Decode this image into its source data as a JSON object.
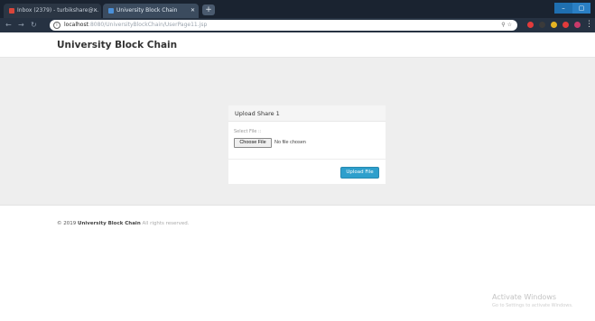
{
  "browser": {
    "tabs": [
      {
        "label": "Inbox (2379) - turbikshare@...",
        "favicon_color": "#d9453a"
      },
      {
        "label": "University Block Chain",
        "favicon_color": "#4a90d9"
      }
    ],
    "address": {
      "host": "localhost",
      "path": ":8080/UniversityBlockChain/UserPage11.jsp"
    }
  },
  "page": {
    "brand": "University Block Chain",
    "upload": {
      "title": "Upload Share 1",
      "select_label": "Select File ::",
      "choose_button": "Choose File",
      "no_file": "No file chosen",
      "upload_button": "Upload File"
    },
    "footer": {
      "copyright": "© 2019",
      "org": "University Block Chain",
      "rights": "All rights reserved."
    }
  },
  "os": {
    "watermark_title": "Activate Windows",
    "watermark_sub": "Go to Settings to activate Windows."
  }
}
